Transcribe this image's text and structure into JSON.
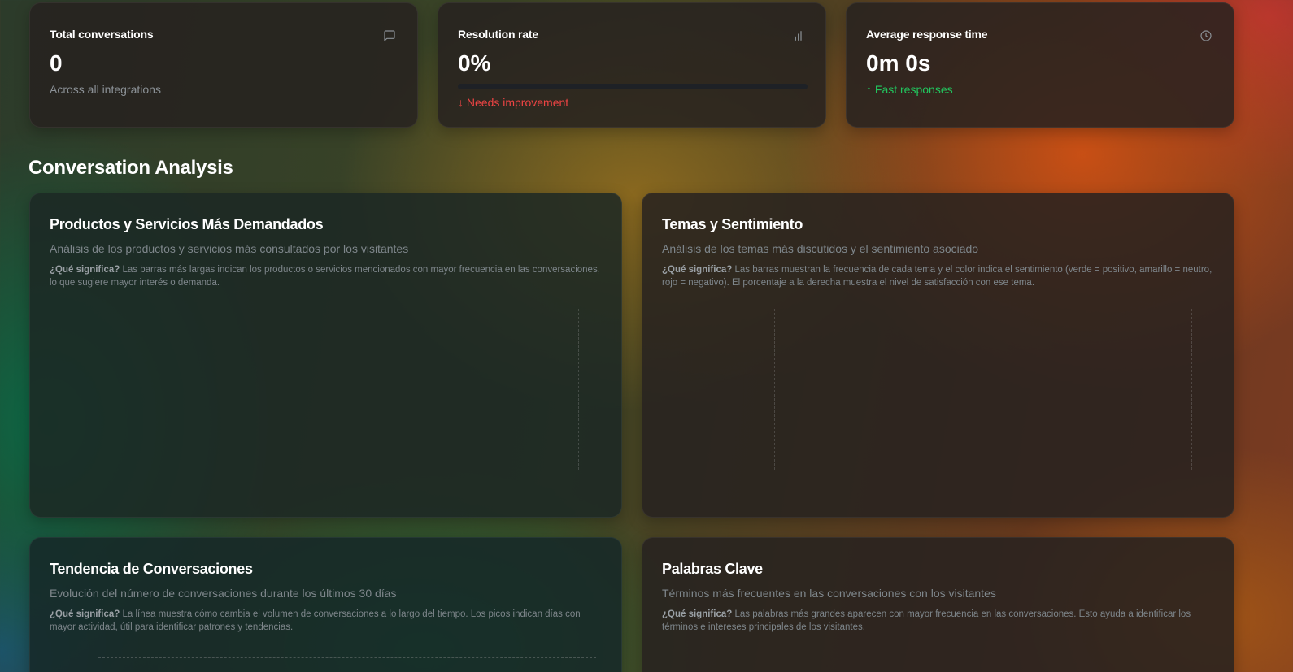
{
  "stats": [
    {
      "title": "Total conversations",
      "value": "0",
      "sub": "Across all integrations",
      "icon": "message-square-icon"
    },
    {
      "title": "Resolution rate",
      "value": "0%",
      "progress": 0,
      "sub": "↓ Needs improvement",
      "icon": "bar-chart-icon"
    },
    {
      "title": "Average response time",
      "value": "0m 0s",
      "sub": "↑ Fast responses",
      "icon": "clock-icon"
    }
  ],
  "section_title": "Conversation Analysis",
  "panels": [
    {
      "title": "Productos y Servicios Más Demandados",
      "desc": "Análisis de los productos y servicios más consultados por los visitantes",
      "note_label": "¿Qué significa?",
      "note_text": " Las barras más largas indican los productos o servicios mencionados con mayor frecuencia en las conversaciones, lo que sugiere mayor interés o demanda."
    },
    {
      "title": "Temas y Sentimiento",
      "desc": "Análisis de los temas más discutidos y el sentimiento asociado",
      "note_label": "¿Qué significa?",
      "note_text": " Las barras muestran la frecuencia de cada tema y el color indica el sentimiento (verde = positivo, amarillo = neutro, rojo = negativo). El porcentaje a la derecha muestra el nivel de satisfacción con ese tema."
    },
    {
      "title": "Tendencia de Conversaciones",
      "desc": "Evolución del número de conversaciones durante los últimos 30 días",
      "note_label": "¿Qué significa?",
      "note_text": " La línea muestra cómo cambia el volumen de conversaciones a lo largo del tiempo. Los picos indican días con mayor actividad, útil para identificar patrones y tendencias."
    },
    {
      "title": "Palabras Clave",
      "desc": "Términos más frecuentes en las conversaciones con los visitantes",
      "note_label": "¿Qué significa?",
      "note_text": " Las palabras más grandes aparecen con mayor frecuencia en las conversaciones. Esto ayuda a identificar los términos e intereses principales de los visitantes."
    }
  ],
  "colors": {
    "positive": "#22c55e",
    "negative": "#ef4444",
    "muted": "#7e868b"
  }
}
